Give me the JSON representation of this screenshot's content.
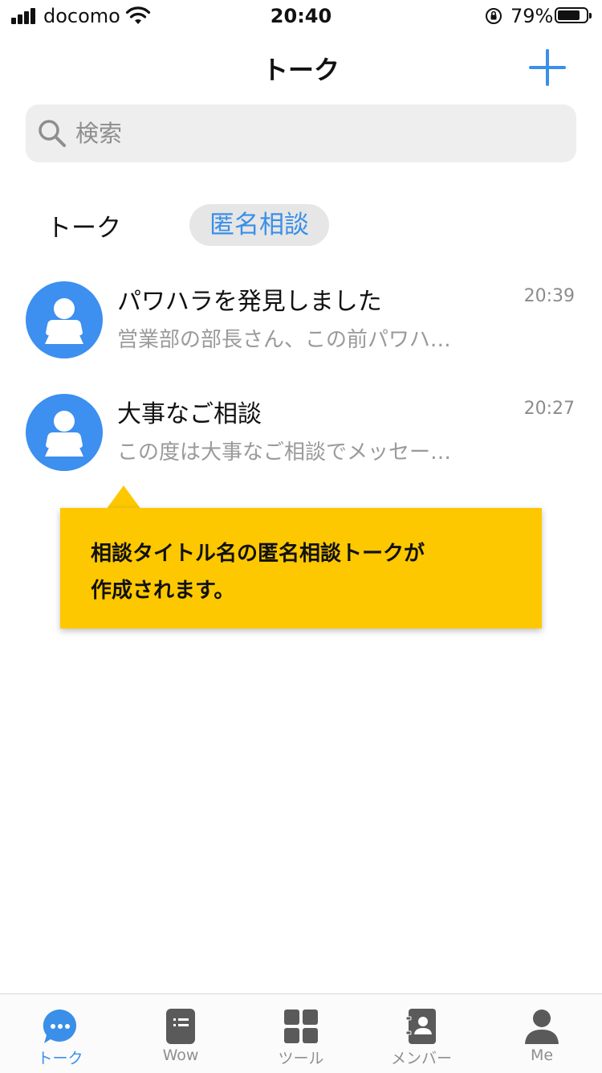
{
  "status_bar": {
    "carrier": "docomo",
    "time": "20:40",
    "battery_percent": "79%",
    "battery_level": 0.79
  },
  "header": {
    "title": "トーク",
    "add_icon": "plus-icon"
  },
  "search": {
    "placeholder": "検索",
    "value": ""
  },
  "tabs": [
    {
      "label": "トーク",
      "selected": false
    },
    {
      "label": "匿名相談",
      "selected": true
    }
  ],
  "chats": [
    {
      "title": "パワハラを発見しました",
      "time": "20:39",
      "preview": "営業部の部長さん、この前パワハ…"
    },
    {
      "title": "大事なご相談",
      "time": "20:27",
      "preview": "この度は大事なご相談でメッセー…"
    }
  ],
  "callout": {
    "line1": "相談タイトル名の匿名相談トークが",
    "line2": "作成されます。"
  },
  "tab_bar": [
    {
      "label": "トーク",
      "icon": "chat-bubble-icon",
      "active": true
    },
    {
      "label": "Wow",
      "icon": "document-list-icon",
      "active": false
    },
    {
      "label": "ツール",
      "icon": "grid-icon",
      "active": false
    },
    {
      "label": "メンバー",
      "icon": "contacts-icon",
      "active": false
    },
    {
      "label": "Me",
      "icon": "person-icon",
      "active": false
    }
  ],
  "colors": {
    "accent": "#3a8fe8",
    "avatar": "#3d8ff0",
    "callout": "#fdc800",
    "inactive": "#8f8f8f"
  }
}
